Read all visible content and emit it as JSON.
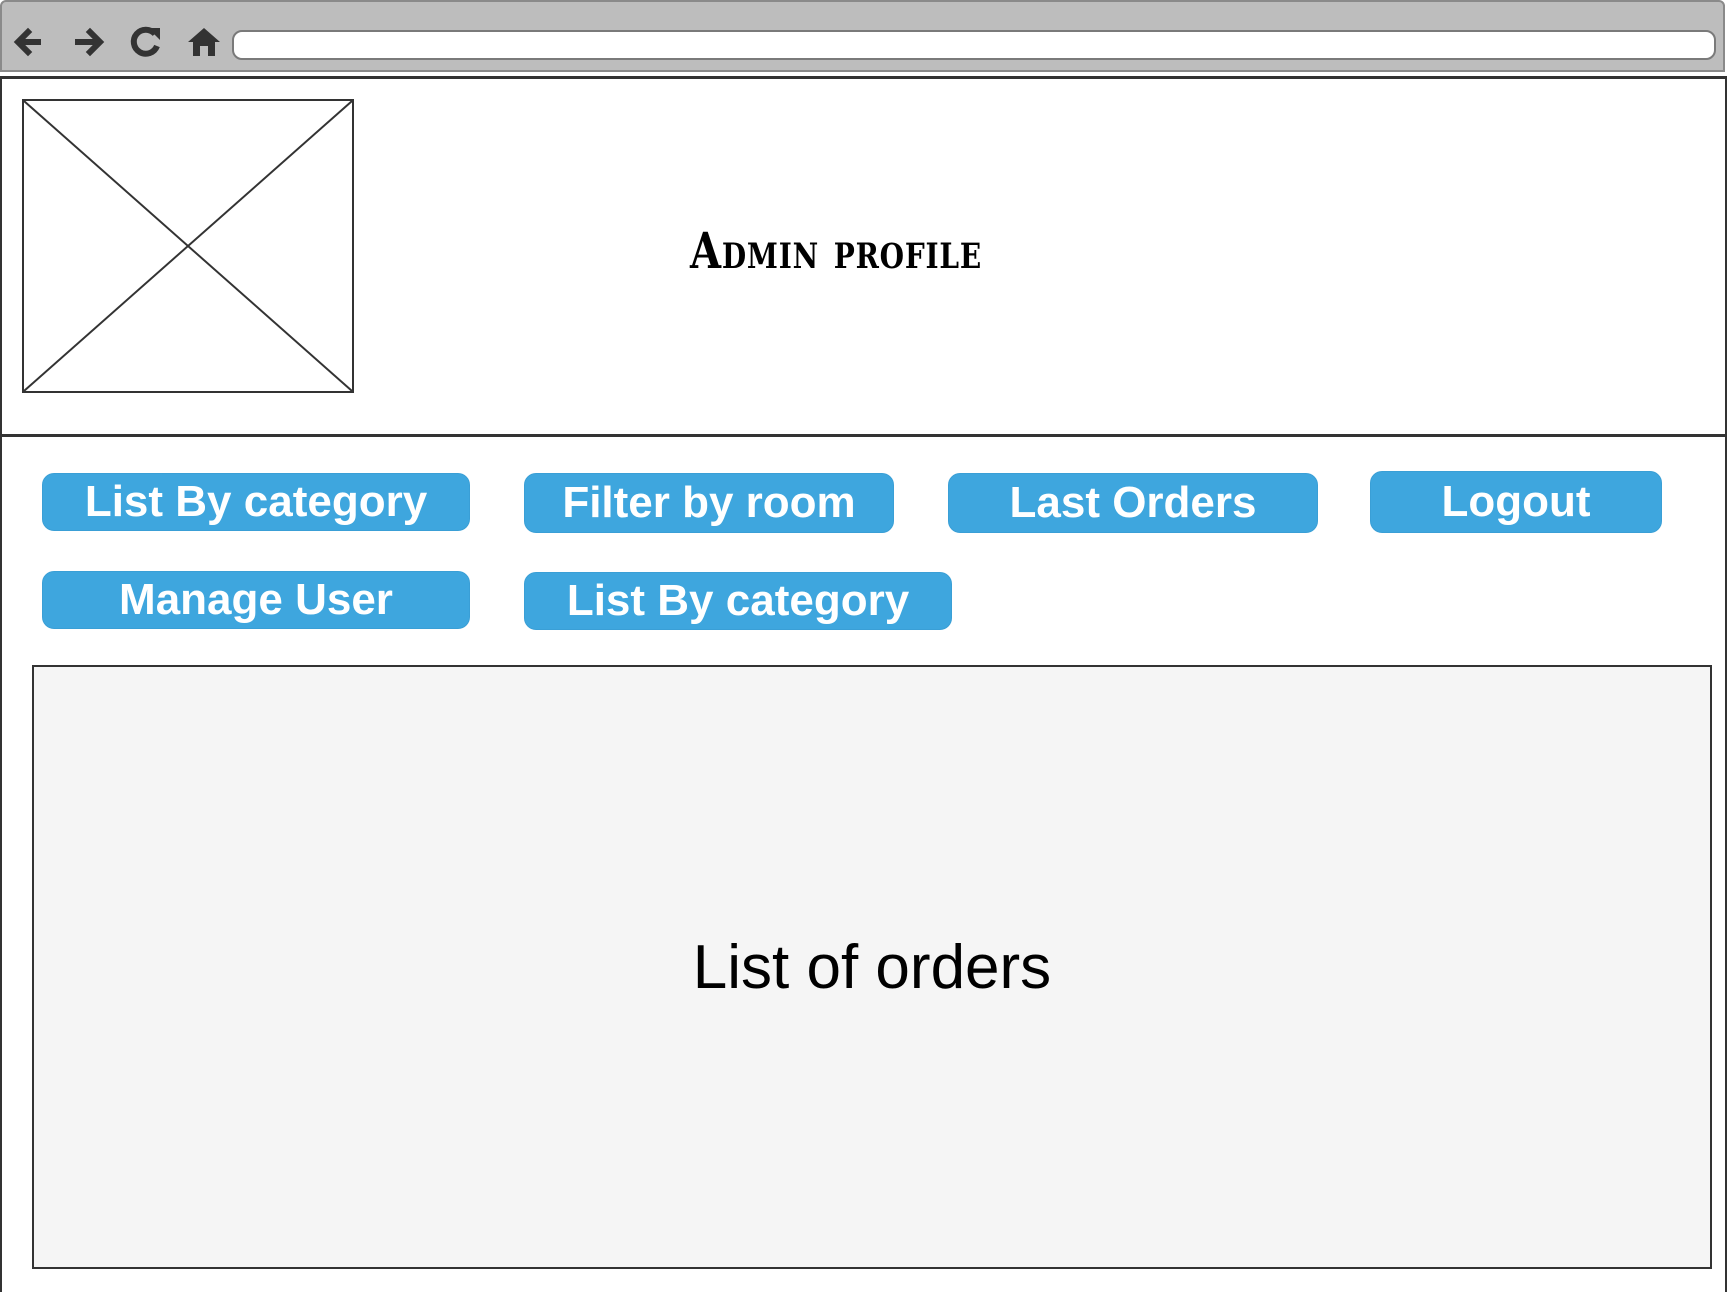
{
  "browser": {
    "address_value": "",
    "icons": [
      "back-arrow-icon",
      "forward-arrow-icon",
      "reload-icon",
      "home-icon"
    ]
  },
  "header": {
    "title": "Admin profile",
    "logo": "image-placeholder"
  },
  "buttons": {
    "row1": [
      {
        "label": "List By category"
      },
      {
        "label": "Filter by room"
      },
      {
        "label": "Last Orders"
      },
      {
        "label": "Logout"
      }
    ],
    "row2": [
      {
        "label": "Manage User"
      },
      {
        "label": "List By category"
      }
    ]
  },
  "main": {
    "orders_label": "List of orders"
  },
  "colors": {
    "button_bg": "#3ea6de",
    "button_text": "#ffffff",
    "chrome_bg": "#bdbdbd",
    "panel_bg": "#f5f5f5"
  }
}
